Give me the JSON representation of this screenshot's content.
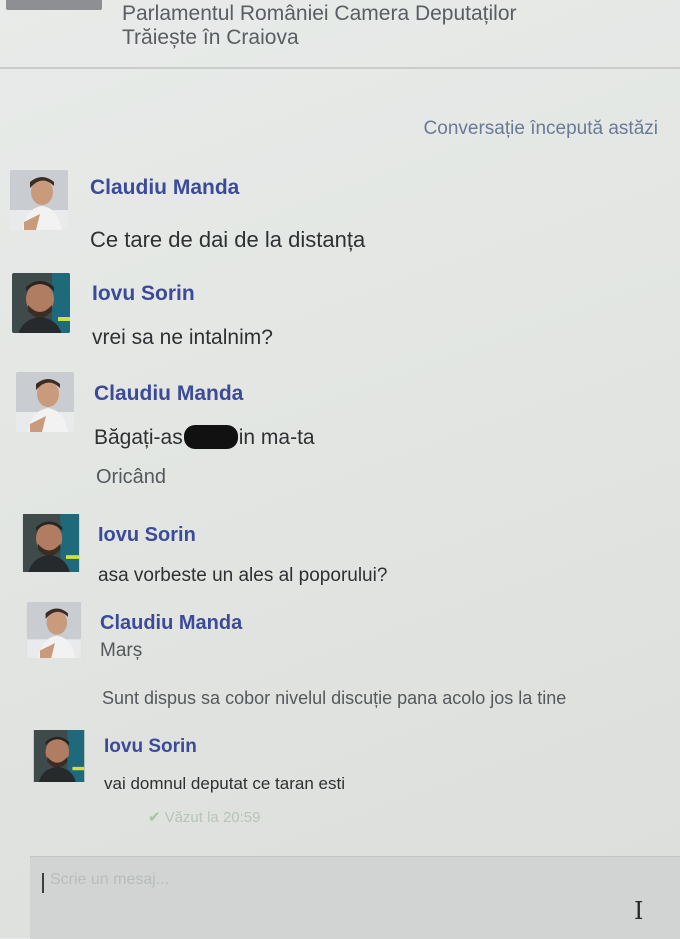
{
  "header": {
    "line1": "Parlamentul României Camera Deputaților",
    "line2": "Trăiește în Craiova"
  },
  "conversation_start": "Conversație începută astăzi",
  "messages": [
    {
      "sender": "Claudiu Manda",
      "lines": [
        "Ce tare de dai de la distanța"
      ]
    },
    {
      "sender": "Iovu Sorin",
      "lines": [
        "vrei sa ne intalnim?"
      ]
    },
    {
      "sender": "Claudiu Manda",
      "line1_before": "Băgați-as",
      "line1_after": "in ma-ta",
      "lines": [
        "Oricând"
      ]
    },
    {
      "sender": "Iovu Sorin",
      "lines": [
        "asa vorbeste un ales al poporului?"
      ]
    },
    {
      "sender": "Claudiu Manda",
      "lines": [
        "Marș",
        "Sunt dispus sa cobor nivelul discuție pana acolo jos la tine"
      ]
    },
    {
      "sender": "Iovu Sorin",
      "lines": [
        "vai domnul deputat ce taran esti"
      ]
    }
  ],
  "seen_status": "Văzut la 20:59",
  "composer": {
    "placeholder": "Scrie un mesaj..."
  },
  "colors": {
    "name": "#3b4b9a",
    "text": "#2e3033",
    "meta": "#6b7a95"
  },
  "icons": [
    "user-photo-icon",
    "checkmark-icon",
    "text-cursor-icon"
  ]
}
